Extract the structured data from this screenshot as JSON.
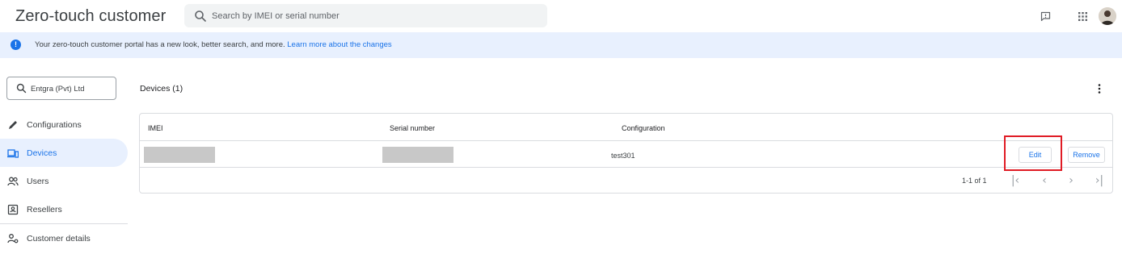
{
  "header": {
    "title": "Zero-touch customer",
    "search_placeholder": "Search by IMEI or serial number",
    "icons": [
      "search-icon",
      "feedback-icon",
      "apps-grid-icon",
      "avatar"
    ]
  },
  "banner": {
    "message": "Your zero-touch customer portal has a new look, better search, and more. ",
    "link": "Learn more about the changes"
  },
  "sidebar": {
    "org_name": "Entgra (Pvt) Ltd",
    "items": [
      {
        "label": "Configurations",
        "icon": "pencil-icon",
        "active": false
      },
      {
        "label": "Devices",
        "icon": "devices-icon",
        "active": true
      },
      {
        "label": "Users",
        "icon": "users-icon",
        "active": false
      },
      {
        "label": "Resellers",
        "icon": "resellers-icon",
        "active": false
      }
    ],
    "customer_details": {
      "label": "Customer details",
      "icon": "customer-details-icon"
    }
  },
  "main": {
    "title": "Devices (1)",
    "table": {
      "columns": [
        "IMEI",
        "Serial number",
        "Configuration"
      ],
      "rows": [
        {
          "imei": "",
          "serial": "",
          "configuration": "test301"
        }
      ],
      "actions": {
        "edit": "Edit",
        "remove": "Remove"
      },
      "range": "1-1 of 1"
    }
  },
  "colors": {
    "accent": "#1a73e8",
    "banner_bg": "#e8f0fe",
    "highlight": "#e01b24"
  }
}
